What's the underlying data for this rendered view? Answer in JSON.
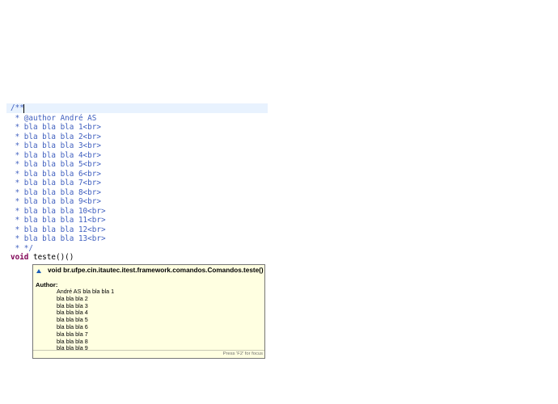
{
  "editor": {
    "comment_open": "/**",
    "author_line": " * @author André AS",
    "doc_lines": [
      " * bla bla bla 1<br>",
      " * bla bla bla 2<br>",
      " * bla bla bla 3<br>",
      " * bla bla bla 4<br>",
      " * bla bla bla 5<br>",
      " * bla bla bla 6<br>",
      " * bla bla bla 7<br>",
      " * bla bla bla 8<br>",
      " * bla bla bla 9<br>",
      " * bla bla bla 10<br>",
      " * bla bla bla 11<br>",
      " * bla bla bla 12<br>",
      " * bla bla bla 13<br>"
    ],
    "comment_close": " * */",
    "method_keyword": "void",
    "method_rest": " teste()()"
  },
  "hover": {
    "signature": "void br.ufpe.cin.itautec.itest.framework.comandos.Comandos.teste()",
    "author_label": "Author:",
    "doc_lines": [
      "André AS bla bla bla 1",
      "bla bla bla 2",
      "bla bla bla 3",
      "bla bla bla 4",
      "bla bla bla 5",
      "bla bla bla 6",
      "bla bla bla 7",
      "bla bla bla 8",
      "bla bla bla 9"
    ],
    "focus_hint": "Press 'F2' for focus"
  },
  "colors": {
    "javadoc": "#3f5fbf",
    "keyword": "#7f0055",
    "current_line": "#e8f2fe",
    "hover_bg": "#ffffe1"
  }
}
